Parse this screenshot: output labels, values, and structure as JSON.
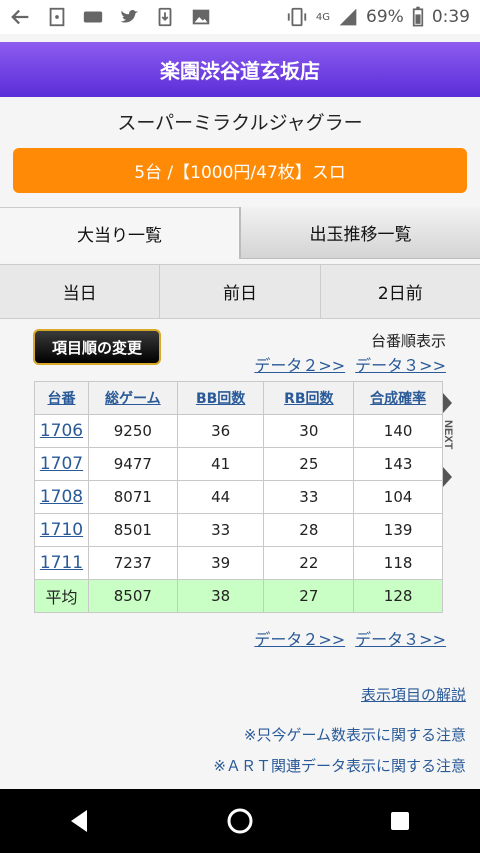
{
  "status": {
    "network": "4G",
    "battery": "69%",
    "time": "0:39"
  },
  "header": {
    "title": "楽園渋谷道玄坂店"
  },
  "machine": {
    "name": "スーパーミラクルジャグラー"
  },
  "info_bar": {
    "text": "5台 /【1000円/47枚】スロ"
  },
  "tabs_main": [
    "大当り一覧",
    "出玉推移一覧"
  ],
  "tabs_day": [
    "当日",
    "前日",
    "2日前"
  ],
  "sort": {
    "button": "項目順の変更",
    "mode": "台番順表示"
  },
  "data_links": [
    "データ２>>",
    "データ３>>"
  ],
  "table": {
    "headers": [
      "台番",
      "総ゲーム",
      "BB回数",
      "RB回数",
      "合成確率"
    ],
    "rows": [
      [
        "1706",
        "9250",
        "36",
        "30",
        "140"
      ],
      [
        "1707",
        "9477",
        "41",
        "25",
        "143"
      ],
      [
        "1708",
        "8071",
        "44",
        "33",
        "104"
      ],
      [
        "1710",
        "8501",
        "33",
        "28",
        "139"
      ],
      [
        "1711",
        "7237",
        "39",
        "22",
        "118"
      ]
    ],
    "average": [
      "平均",
      "8507",
      "38",
      "27",
      "128"
    ]
  },
  "next_label": "NEXT",
  "footer_links": {
    "explain": "表示項目の解説",
    "note1": "※只今ゲーム数表示に関する注意",
    "note2": "※ＡＲＴ関連データ表示に関する注意"
  },
  "colors": {
    "header": "#6a3ee0",
    "info_bar": "#ff8a06",
    "link": "#2a5a98",
    "average_row": "#c9ffc4"
  }
}
